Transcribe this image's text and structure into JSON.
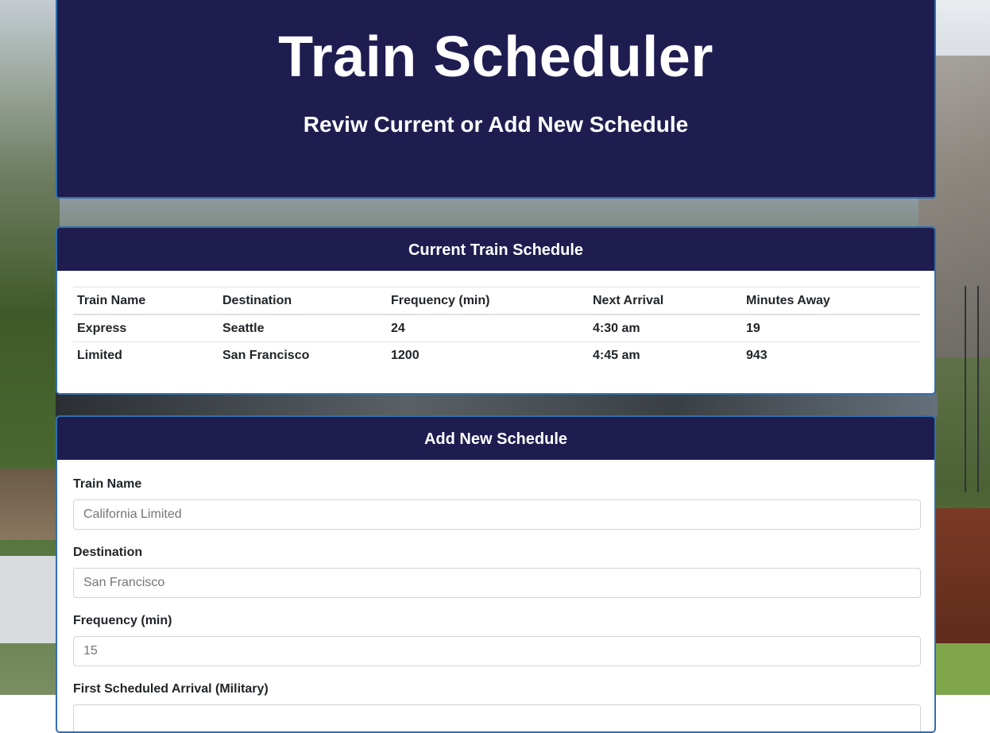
{
  "header": {
    "title": "Train Scheduler",
    "subtitle": "Reviw Current or Add New Schedule"
  },
  "schedule": {
    "title": "Current Train Schedule",
    "columns": [
      "Train Name",
      "Destination",
      "Frequency (min)",
      "Next Arrival",
      "Minutes Away"
    ],
    "rows": [
      [
        "Express",
        "Seattle",
        "24",
        "4:30 am",
        "19"
      ],
      [
        "Limited",
        "San Francisco",
        "1200",
        "4:45 am",
        "943"
      ]
    ]
  },
  "add_form": {
    "title": "Add New Schedule",
    "fields": [
      {
        "label": "Train Name",
        "placeholder": "California Limited"
      },
      {
        "label": "Destination",
        "placeholder": "San Francisco"
      },
      {
        "label": "Frequency (min)",
        "placeholder": "15"
      },
      {
        "label": "First Scheduled Arrival (Military)",
        "placeholder": ""
      }
    ]
  }
}
